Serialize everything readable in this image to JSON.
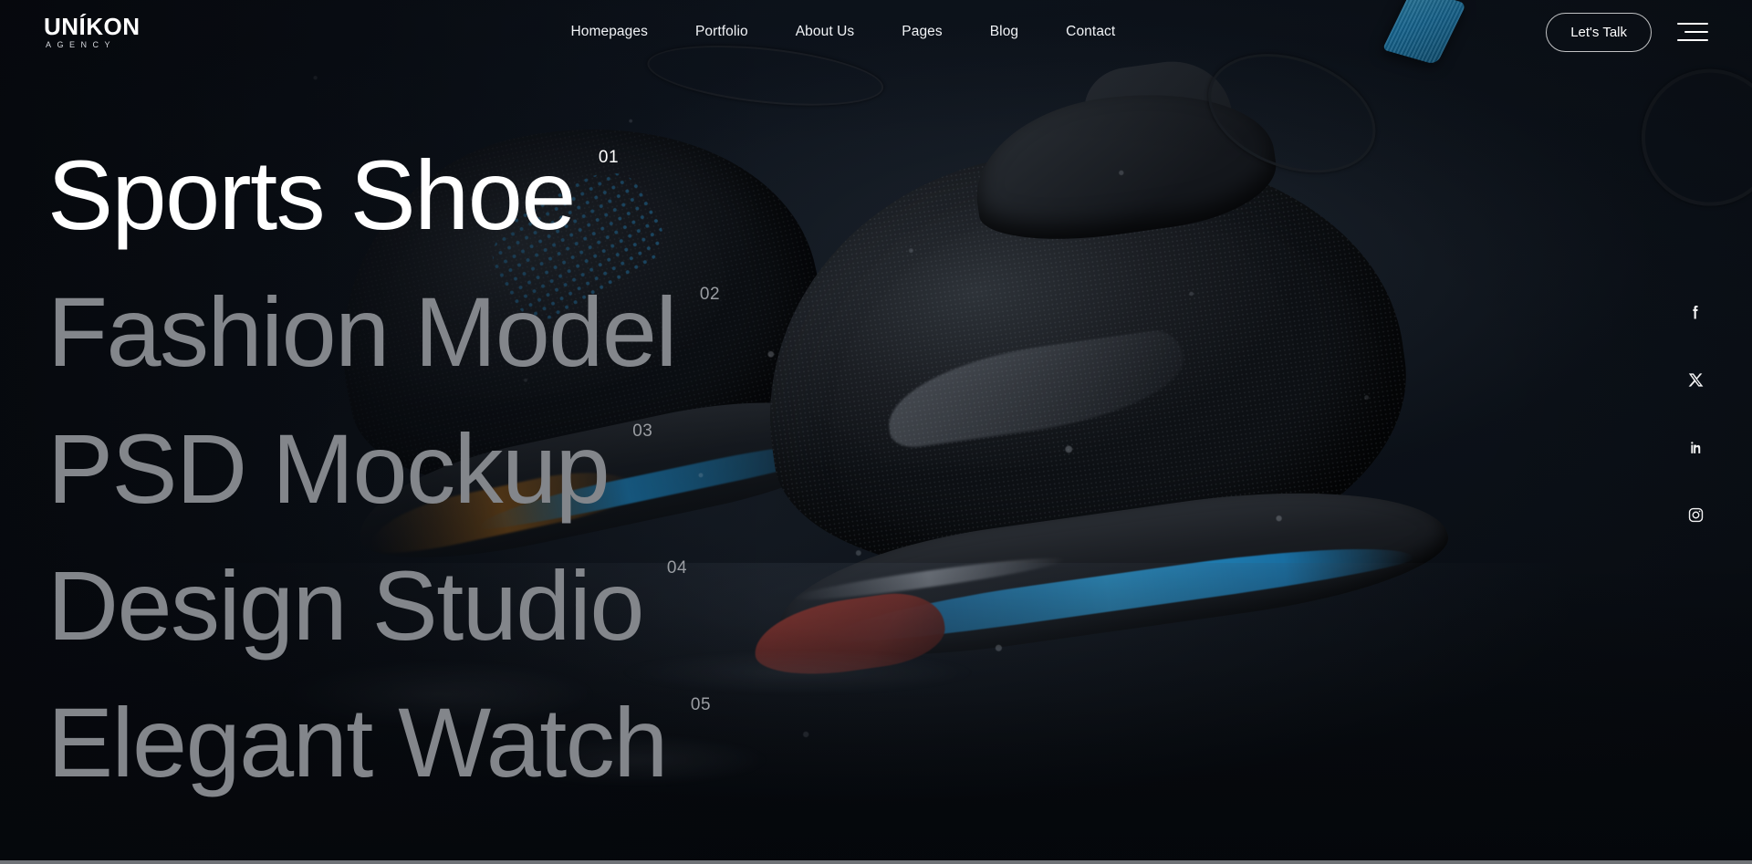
{
  "brand": {
    "name": "UNÍKON",
    "tagline": "AGENCY"
  },
  "nav": {
    "items": [
      {
        "label": "Homepages"
      },
      {
        "label": "Portfolio"
      },
      {
        "label": "About Us"
      },
      {
        "label": "Pages"
      },
      {
        "label": "Blog"
      },
      {
        "label": "Contact"
      }
    ]
  },
  "header_actions": {
    "cta_label": "Let's Talk",
    "menu_icon": "hamburger-icon"
  },
  "hero": {
    "items": [
      {
        "title": "Sports Shoe",
        "number": "01",
        "active": true
      },
      {
        "title": "Fashion Model",
        "number": "02",
        "active": false
      },
      {
        "title": "PSD Mockup",
        "number": "03",
        "active": false
      },
      {
        "title": "Design Studio",
        "number": "04",
        "active": false
      },
      {
        "title": "Elegant Watch",
        "number": "05",
        "active": false
      }
    ]
  },
  "social": {
    "items": [
      {
        "name": "facebook-icon",
        "label": "Facebook"
      },
      {
        "name": "x-twitter-icon",
        "label": "X"
      },
      {
        "name": "linkedin-icon",
        "label": "LinkedIn"
      },
      {
        "name": "instagram-icon",
        "label": "Instagram"
      }
    ]
  },
  "colors": {
    "background": "#0b1017",
    "text_active": "#ffffff",
    "text_muted": "#83868b",
    "accent_blue": "#1b86bf",
    "accent_red": "#c0392b"
  }
}
